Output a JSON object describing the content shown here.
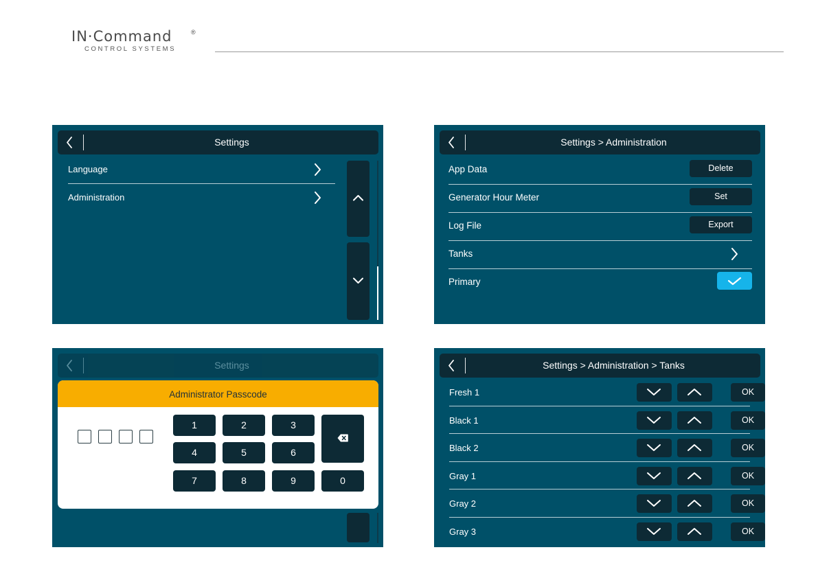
{
  "brand": {
    "name": "IN·Command",
    "mark": "®",
    "subtitle": "CONTROL SYSTEMS"
  },
  "colors": {
    "panel_bg": "#005068",
    "bar_bg": "#0d2a35",
    "accent": "#16b4ea",
    "modal_header": "#f8ad00"
  },
  "icons": {
    "back": "chevron-left-icon",
    "forward": "chevron-right-icon",
    "up": "chevron-up-icon",
    "down": "chevron-down-icon",
    "check": "check-icon",
    "backspace": "backspace-icon"
  },
  "screen1": {
    "title": "Settings",
    "items": [
      {
        "label": "Language"
      },
      {
        "label": "Administration"
      }
    ]
  },
  "screen2": {
    "title": "Settings > Administration",
    "rows": [
      {
        "label": "App Data",
        "button": "Delete"
      },
      {
        "label": "Generator Hour Meter",
        "button": "Set"
      },
      {
        "label": "Log File",
        "button": "Export"
      },
      {
        "label": "Tanks"
      },
      {
        "label": "Primary",
        "checked": true
      }
    ]
  },
  "screen3": {
    "title": "Settings",
    "modal_title": "Administrator Passcode",
    "keys": [
      "1",
      "2",
      "3",
      "4",
      "5",
      "6",
      "7",
      "8",
      "9",
      "0"
    ]
  },
  "screen4": {
    "title": "Settings > Administration > Tanks",
    "ok_label": "OK",
    "tanks": [
      {
        "label": "Fresh 1"
      },
      {
        "label": "Black 1"
      },
      {
        "label": "Black 2"
      },
      {
        "label": "Gray 1"
      },
      {
        "label": "Gray 2"
      },
      {
        "label": "Gray 3"
      }
    ]
  }
}
